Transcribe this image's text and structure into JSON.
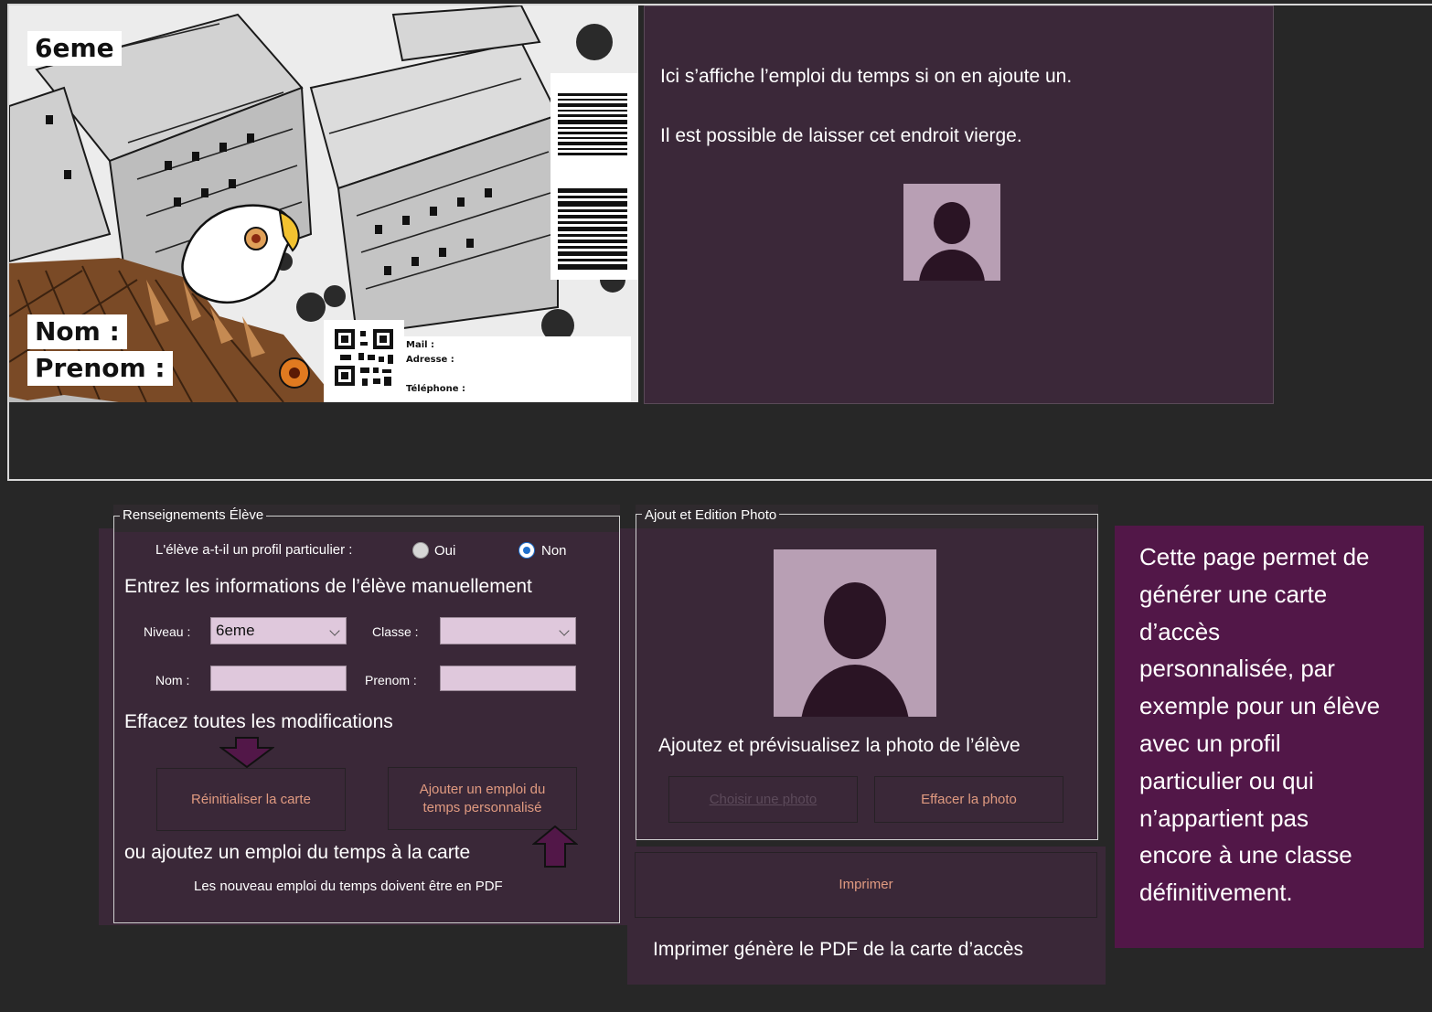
{
  "card": {
    "level": "6eme",
    "nom_label": "Nom :",
    "prenom_label": "Prenom :",
    "mail_label": "Mail :",
    "adresse_label": "Adresse :",
    "telephone_label": "Téléphone :"
  },
  "timetable": {
    "line1": "Ici s’affiche l’emploi du temps si on en ajoute un.",
    "line2": "Il est possible de laisser cet endroit vierge."
  },
  "student_group": {
    "title": "Renseignements Élève",
    "profile_question": "L'élève a-t-il un profil particulier :",
    "radio_yes": "Oui",
    "radio_no": "Non",
    "selected_radio": "Non",
    "niveau_label": "Niveau :",
    "niveau_value": "6eme",
    "classe_label": "Classe :",
    "classe_value": "",
    "nom_label": "Nom :",
    "nom_value": "",
    "prenom_label": "Prenom :",
    "prenom_value": "",
    "reset_button": "Réinitialiser la carte",
    "add_timetable_button_line1": "Ajouter un emploi du",
    "add_timetable_button_line2": "temps personnalisé",
    "pdf_note": "Les nouveau emploi du temps doivent être en PDF"
  },
  "photo_group": {
    "title": "Ajout et Edition Photo",
    "choose_button": "Choisir une photo",
    "clear_button": "Effacer la photo"
  },
  "print_button": "Imprimer",
  "annotations": {
    "manual_entry": "Entrez les informations de l’élève manuellement",
    "clear_all": "Effacez toutes les modifications",
    "add_timetable": "ou ajoutez un emploi du temps à la carte",
    "photo_preview": "Ajoutez et prévisualisez la photo de l’élève",
    "print_info": "Imprimer génère le PDF de la carte d’accès"
  },
  "info_box": {
    "lines": [
      "Cette page permet de",
      "générer une carte",
      "d’accès",
      "personnalisée, par",
      "exemple pour un élève",
      "avec un profil",
      "particulier ou qui",
      "n’appartient pas",
      "encore à une classe",
      "définitivement."
    ]
  },
  "colors": {
    "background": "#272727",
    "panel": "#3a2838",
    "info_box": "#521748",
    "button_text": "#e09a80",
    "input_fill": "#dfc8dc",
    "radio_accent": "#1e6fcc",
    "arrow": "#521748"
  }
}
